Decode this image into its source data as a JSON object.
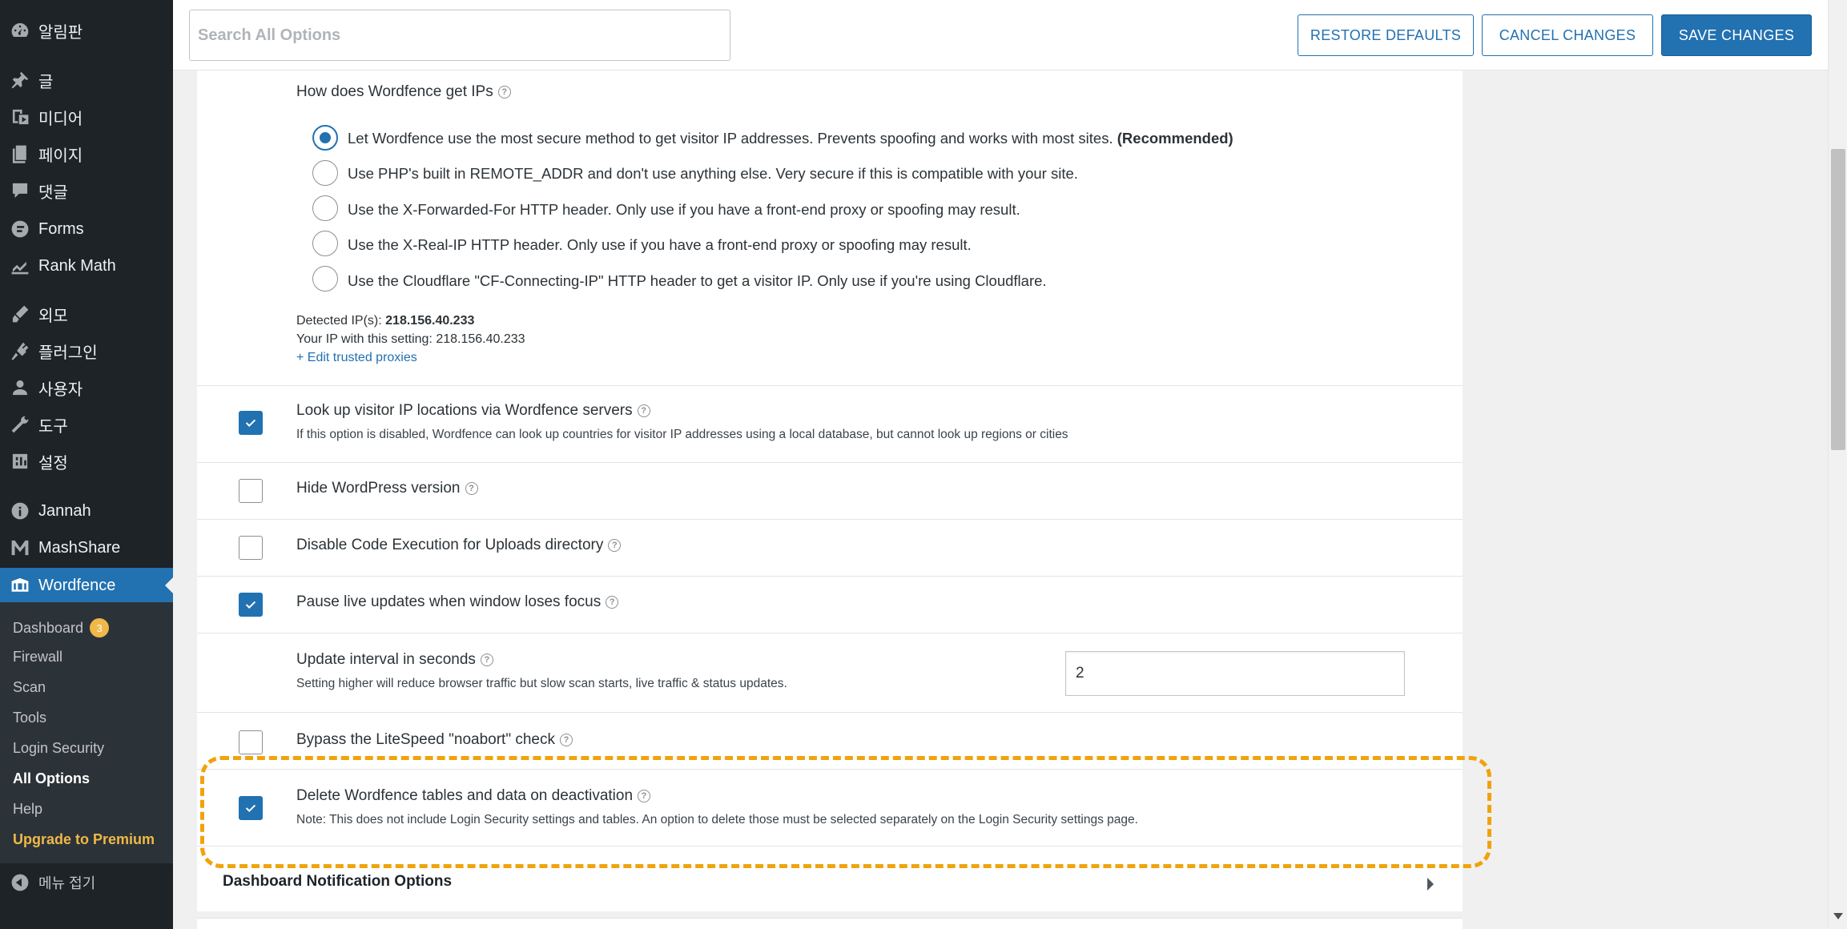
{
  "sidebar": {
    "items": [
      {
        "label": "알림판",
        "icon": "dashboard-icon"
      },
      {
        "label": "글",
        "icon": "pin-icon"
      },
      {
        "label": "미디어",
        "icon": "media-icon"
      },
      {
        "label": "페이지",
        "icon": "pages-icon"
      },
      {
        "label": "댓글",
        "icon": "comments-icon"
      },
      {
        "label": "Forms",
        "icon": "forms-icon"
      },
      {
        "label": "Rank Math",
        "icon": "rank-math-icon"
      },
      {
        "label": "외모",
        "icon": "appearance-icon"
      },
      {
        "label": "플러그인",
        "icon": "plugins-icon"
      },
      {
        "label": "사용자",
        "icon": "users-icon"
      },
      {
        "label": "도구",
        "icon": "tools-icon"
      },
      {
        "label": "설정",
        "icon": "settings-icon"
      },
      {
        "label": "Jannah",
        "icon": "jannah-icon"
      },
      {
        "label": "MashShare",
        "icon": "mashshare-icon"
      },
      {
        "label": "Wordfence",
        "icon": "wordfence-icon"
      }
    ],
    "submenu": [
      {
        "label": "Dashboard",
        "badge": "3"
      },
      {
        "label": "Firewall"
      },
      {
        "label": "Scan"
      },
      {
        "label": "Tools"
      },
      {
        "label": "Login Security"
      },
      {
        "label": "All Options"
      },
      {
        "label": "Help"
      },
      {
        "label": "Upgrade to Premium"
      }
    ],
    "collapse_label": "메뉴 접기"
  },
  "toolbar": {
    "search_placeholder": "Search All Options",
    "restore_label": "RESTORE DEFAULTS",
    "cancel_label": "CANCEL CHANGES",
    "save_label": "SAVE CHANGES"
  },
  "ip_section": {
    "title": "How does Wordfence get IPs",
    "options": [
      {
        "text": "Let Wordfence use the most secure method to get visitor IP addresses. Prevents spoofing and works with most sites.",
        "strong": "(Recommended)",
        "checked": true
      },
      {
        "text": "Use PHP's built in REMOTE_ADDR and don't use anything else. Very secure if this is compatible with your site.",
        "checked": false
      },
      {
        "text": "Use the X-Forwarded-For HTTP header. Only use if you have a front-end proxy or spoofing may result.",
        "checked": false
      },
      {
        "text": "Use the X-Real-IP HTTP header. Only use if you have a front-end proxy or spoofing may result.",
        "checked": false
      },
      {
        "text": "Use the Cloudflare \"CF-Connecting-IP\" HTTP header to get a visitor IP. Only use if you're using Cloudflare.",
        "checked": false
      }
    ],
    "detected_label": "Detected IP(s):",
    "detected_value": "218.156.40.233",
    "your_ip_text": "Your IP with this setting: 218.156.40.233",
    "edit_proxies_link": "+ Edit trusted proxies"
  },
  "options": [
    {
      "label": "Look up visitor IP locations via Wordfence servers",
      "desc": "If this option is disabled, Wordfence can look up countries for visitor IP addresses using a local database, but cannot look up regions or cities",
      "checked": true
    },
    {
      "label": "Hide WordPress version",
      "checked": false
    },
    {
      "label": "Disable Code Execution for Uploads directory",
      "checked": false
    },
    {
      "label": "Pause live updates when window loses focus",
      "checked": true
    },
    {
      "label": "Update interval in seconds",
      "desc": "Setting higher will reduce browser traffic but slow scan starts, live traffic & status updates.",
      "value": "2"
    },
    {
      "label": "Bypass the LiteSpeed \"noabort\" check",
      "checked": false
    },
    {
      "label": "Delete Wordfence tables and data on deactivation",
      "desc": "Note: This does not include Login Security settings and tables. An option to delete those must be selected separately on the Login Security settings page.",
      "checked": true
    }
  ],
  "next_section": "Dashboard Notification Options",
  "colors": {
    "accent": "#2271b1",
    "sidebar": "#1d2327",
    "highlight": "#f0a30a",
    "premium": "#f0b849"
  }
}
